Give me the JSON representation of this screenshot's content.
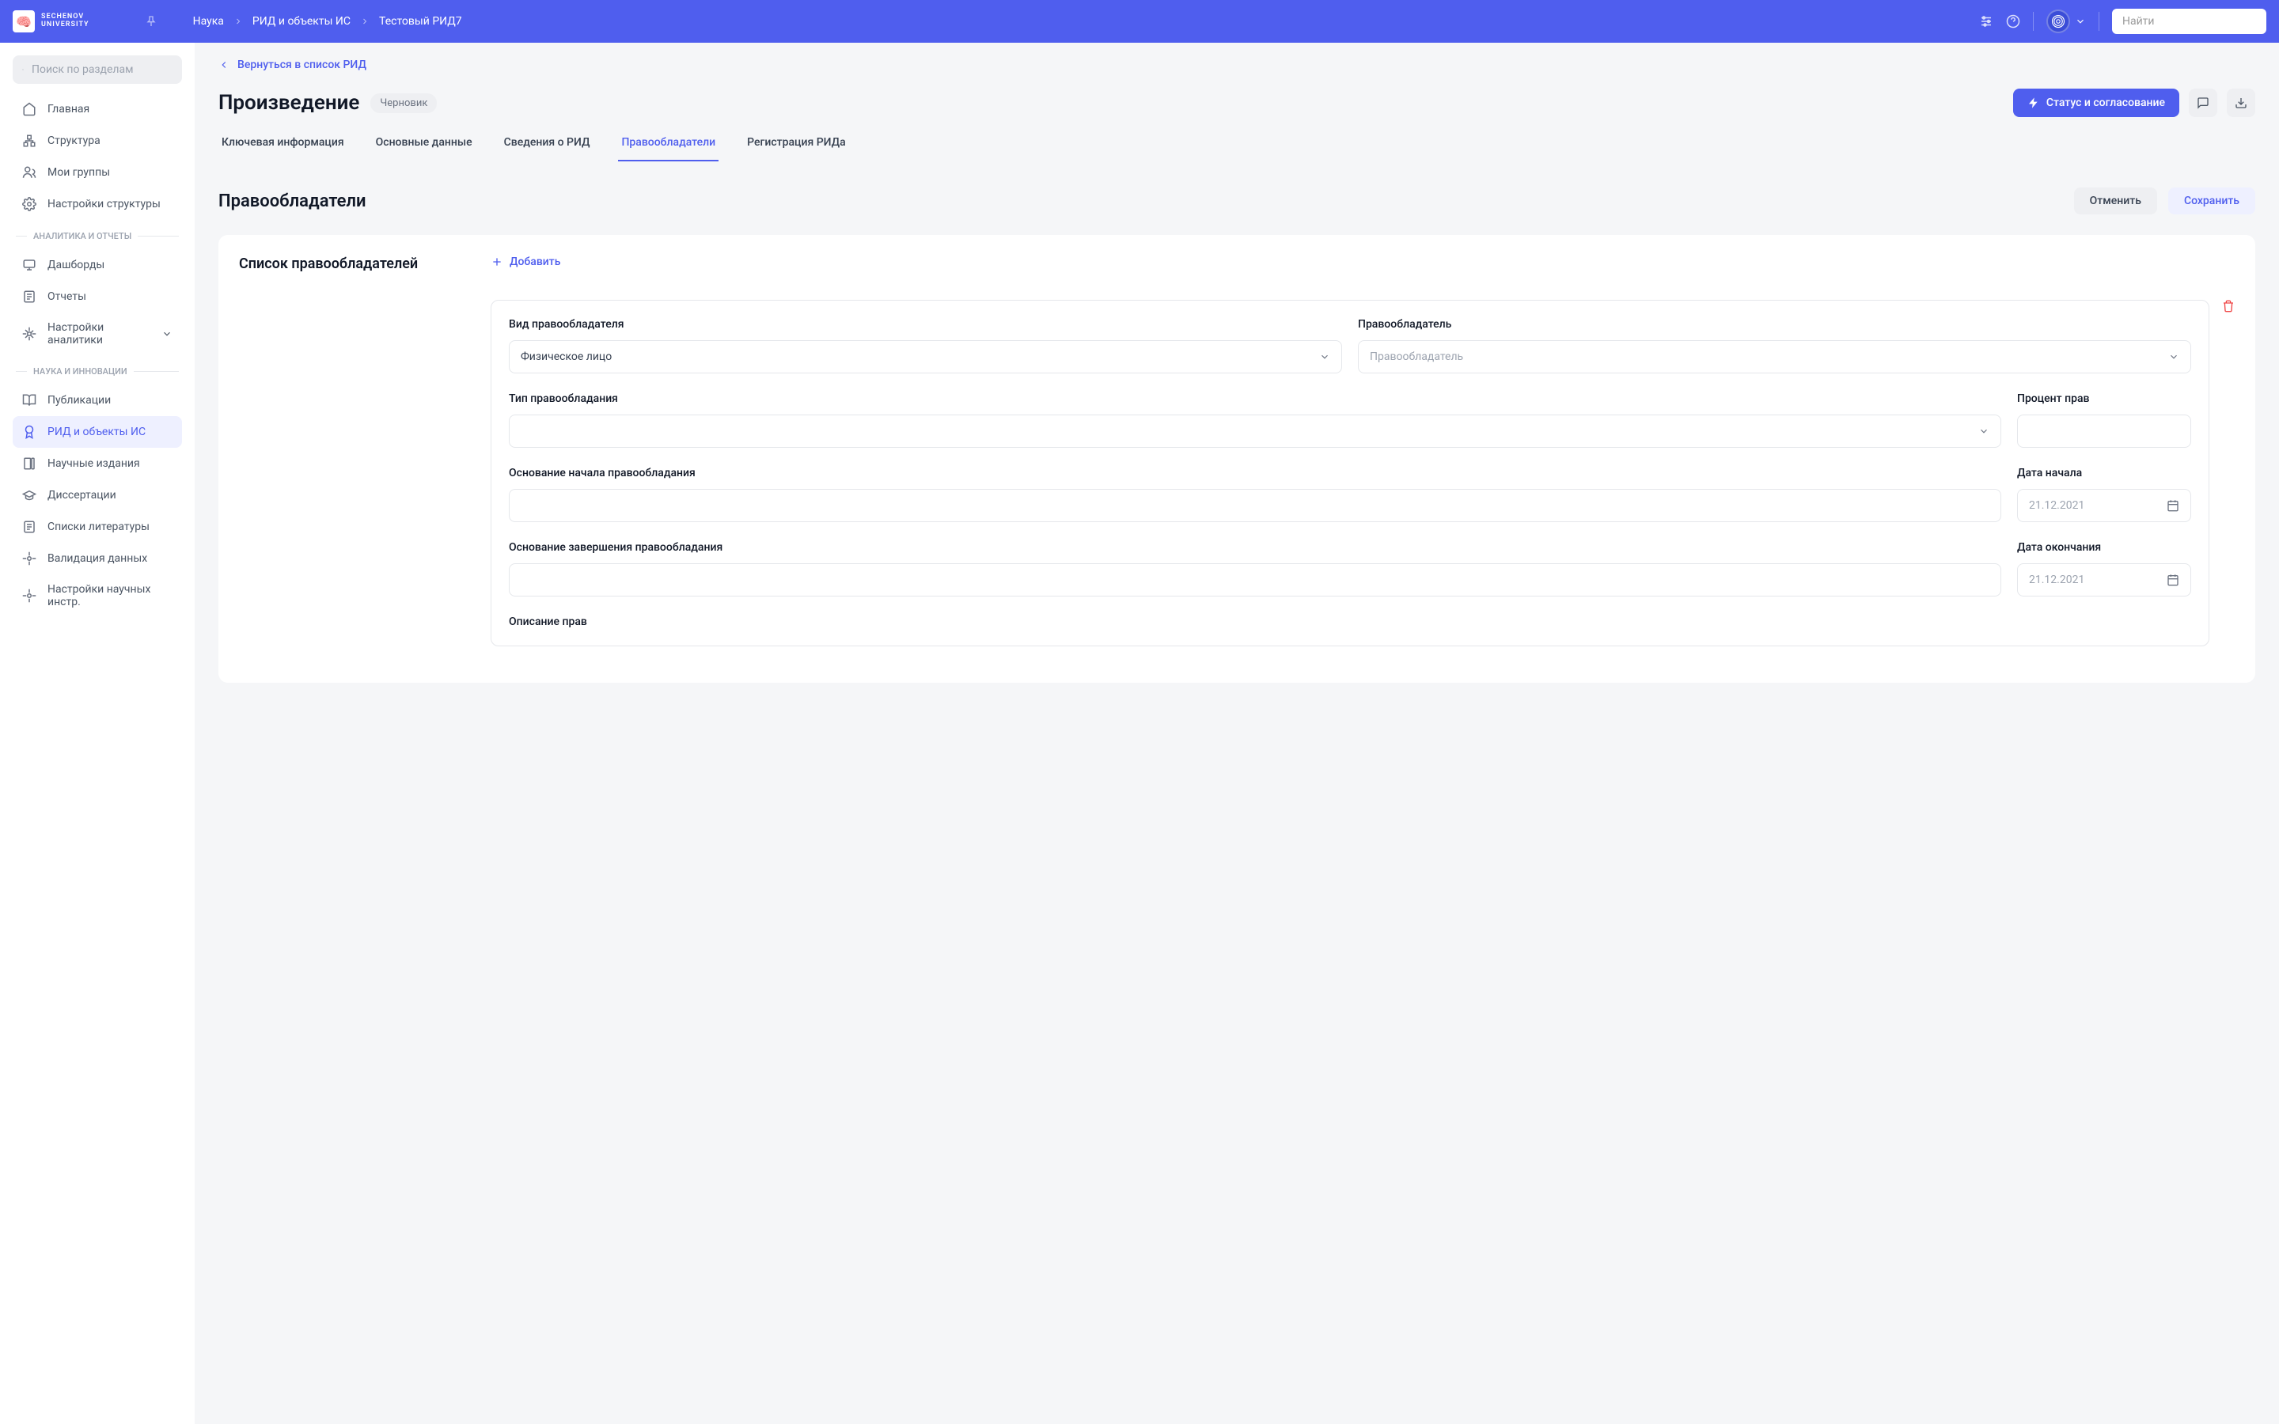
{
  "header": {
    "logo": {
      "line1": "SECHENOV",
      "line2": "UNIVERSITY"
    },
    "breadcrumb": [
      "Наука",
      "РИД и объекты ИС",
      "Тестовый РИД7"
    ],
    "search_placeholder": "Найти"
  },
  "sidebar": {
    "search_placeholder": "Поиск по разделам",
    "items_top": [
      {
        "label": "Главная",
        "icon": "home"
      },
      {
        "label": "Структура",
        "icon": "hierarchy"
      },
      {
        "label": "Мои группы",
        "icon": "users"
      },
      {
        "label": "Настройки структуры",
        "icon": "gear"
      }
    ],
    "section_analytics": "АНАЛИТИКА И ОТЧЕТЫ",
    "items_analytics": [
      {
        "label": "Дашборды",
        "icon": "dashboard"
      },
      {
        "label": "Отчеты",
        "icon": "report"
      },
      {
        "label": "Настройки аналитики",
        "icon": "gear",
        "chevron": true
      }
    ],
    "section_science": "НАУКА И ИННОВАЦИИ",
    "items_science": [
      {
        "label": "Публикации",
        "icon": "book"
      },
      {
        "label": "РИД и объекты ИС",
        "icon": "award",
        "active": true
      },
      {
        "label": "Научные издания",
        "icon": "journals"
      },
      {
        "label": "Диссертации",
        "icon": "grad"
      },
      {
        "label": "Списки литературы",
        "icon": "list"
      },
      {
        "label": "Валидация данных",
        "icon": "gear"
      },
      {
        "label": "Настройки научных инстр.",
        "icon": "gear"
      }
    ]
  },
  "main": {
    "back": "Вернуться в список РИД",
    "title": "Произведение",
    "badge": "Черновик",
    "status_btn": "Статус и согласование",
    "tabs": [
      {
        "label": "Ключевая информация"
      },
      {
        "label": "Основные данные"
      },
      {
        "label": "Сведения о РИД"
      },
      {
        "label": "Правообладатели",
        "active": true
      },
      {
        "label": "Регистрация РИДа"
      }
    ],
    "subtitle": "Правообладатели",
    "cancel": "Отменить",
    "save": "Сохранить",
    "list_title": "Список правообладателей",
    "add": "Добавить",
    "form": {
      "kind_label": "Вид правообладателя",
      "kind_value": "Физическое лицо",
      "holder_label": "Правообладатель",
      "holder_placeholder": "Правообладатель",
      "type_label": "Тип правообладания",
      "percent_label": "Процент прав",
      "basis_start_label": "Основание начала правообладания",
      "date_start_label": "Дата начала",
      "date_start_placeholder": "21.12.2021",
      "basis_end_label": "Основание завершения правообладания",
      "date_end_label": "Дата окончания",
      "date_end_placeholder": "21.12.2021",
      "description_label": "Описание прав"
    }
  }
}
